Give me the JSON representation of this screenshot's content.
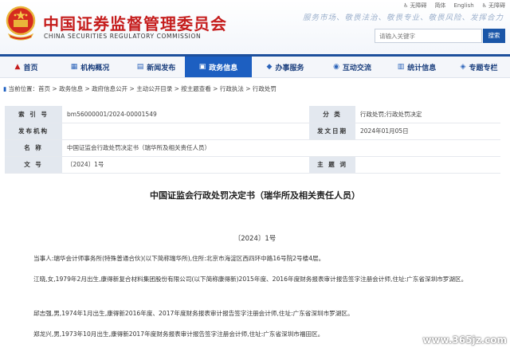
{
  "header": {
    "org_name_cn": "中国证券监督管理委员会",
    "org_name_en": "CHINA SECURITIES REGULATORY COMMISSION",
    "slogan": "服务市场、敬畏法治、敬畏专业、敬畏风险、发挥合力",
    "top_links": [
      "无障碍",
      "简体",
      "English",
      "无障碍"
    ],
    "search_placeholder": "请输入关键字",
    "search_button": "搜索"
  },
  "nav": {
    "items": [
      {
        "label": "首页",
        "icon": "home-icon"
      },
      {
        "label": "机构概况",
        "icon": "building-icon"
      },
      {
        "label": "新闻发布",
        "icon": "news-icon"
      },
      {
        "label": "政务信息",
        "icon": "document-icon"
      },
      {
        "label": "办事服务",
        "icon": "service-icon"
      },
      {
        "label": "互动交流",
        "icon": "chat-icon"
      },
      {
        "label": "统计信息",
        "icon": "stats-icon"
      },
      {
        "label": "专题专栏",
        "icon": "topic-icon"
      }
    ],
    "active_index": 3,
    "accent_color": "#1d5fc1"
  },
  "breadcrumb": {
    "prefix": "当前位置：",
    "items": [
      "首页",
      "政务信息",
      "政府信息公开",
      "主动公开目录",
      "按主题查看",
      "行政执法",
      "行政处罚"
    ],
    "separator": " > "
  },
  "info_table": {
    "index_label": "索 引 号",
    "index_value": "bm56000001/2024-00001549",
    "category_label": "分 类",
    "category_value": "行政处罚;行政处罚决定",
    "issuer_label": "发布机构",
    "issuer_value": "",
    "date_label": "发文日期",
    "date_value": "2024年01月05日",
    "name_label": "名 称",
    "name_value": "中国证监会行政处罚决定书（瑞华所及相关责任人员）",
    "doc_no_label": "文 号",
    "doc_no_value": "〔2024〕1号",
    "keyword_label": "主 题 词",
    "keyword_value": ""
  },
  "document": {
    "title": "中国证监会行政处罚决定书（瑞华所及相关责任人员）",
    "number": "〔2024〕1号",
    "paragraphs": [
      "当事人:瑞华会计师事务所(特殊普通合伙)(以下简称瑞华所),住所:北京市海淀区西四环中路16号院2号楼4层。",
      "江晓,女,1979年2月出生,康得新复合材料集团股份有限公司(以下简称康得新)2015年度、2016年度财务报表审计报告签字注册会计师,住址:广东省深圳市罗湖区。",
      "邱志强,男,1974年1月出生,康得新2016年度、2017年度财务报表审计报告签字注册会计师,住址:广东省深圳市罗湖区。",
      "郑龙兴,男,1973年10月出生,康得新2017年度财务报表审计报告签字注册会计师,住址:广东省深圳市福田区。"
    ]
  },
  "watermark": "www.365jz.com"
}
